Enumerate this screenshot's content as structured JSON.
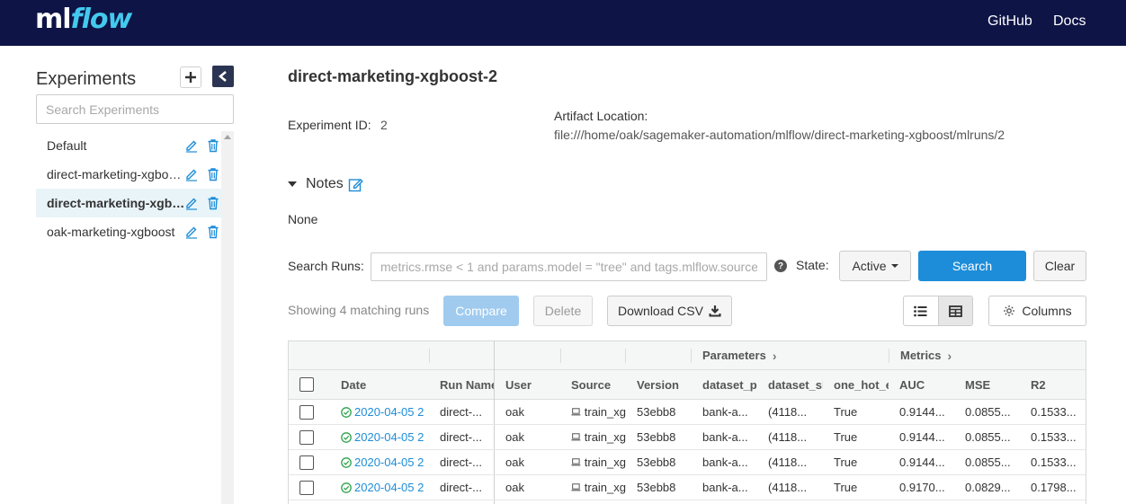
{
  "header": {
    "logo_ml": "ml",
    "logo_flow": "flow",
    "nav": [
      "GitHub",
      "Docs"
    ]
  },
  "sidebar": {
    "title": "Experiments",
    "search_placeholder": "Search Experiments",
    "experiments": [
      {
        "name": "Default",
        "active": false
      },
      {
        "name": "direct-marketing-xgboost",
        "active": false
      },
      {
        "name": "direct-marketing-xgboost-2",
        "active": true
      },
      {
        "name": "oak-marketing-xgboost",
        "active": false
      }
    ]
  },
  "experiment": {
    "title": "direct-marketing-xgboost-2",
    "id_label": "Experiment ID:",
    "id_value": "2",
    "artifact_label": "Artifact Location:",
    "artifact_value": "file:///home/oak/sagemaker-automation/mlflow/direct-marketing-xgboost/mlruns/2",
    "notes_label": "Notes",
    "notes_value": "None"
  },
  "search": {
    "label": "Search Runs:",
    "placeholder": "metrics.rmse < 1 and params.model = \"tree\" and tags.mlflow.source",
    "help_glyph": "?",
    "state_label": "State:",
    "state_value": "Active",
    "search_button": "Search",
    "clear_button": "Clear"
  },
  "toolbar": {
    "showing_text": "Showing 4 matching runs",
    "compare_button": "Compare",
    "delete_button": "Delete",
    "download_button": "Download CSV",
    "columns_button": "Columns"
  },
  "table": {
    "group_parameters": "Parameters",
    "group_metrics": "Metrics",
    "headers": [
      "Date",
      "Run Name",
      "User",
      "Source",
      "Version",
      "dataset_pa",
      "dataset_sh",
      "one_hot_e",
      "AUC",
      "MSE",
      "R2"
    ],
    "rows": [
      {
        "date": "2020-04-05 2",
        "run_name": "direct-...",
        "user": "oak",
        "source": "train_xg",
        "version": "53ebb8",
        "dataset_path": "bank-a...",
        "dataset_shape": "(4118...",
        "one_hot": "True",
        "auc": "0.9144...",
        "mse": "0.0855...",
        "r2": "0.1533..."
      },
      {
        "date": "2020-04-05 2",
        "run_name": "direct-...",
        "user": "oak",
        "source": "train_xg",
        "version": "53ebb8",
        "dataset_path": "bank-a...",
        "dataset_shape": "(4118...",
        "one_hot": "True",
        "auc": "0.9144...",
        "mse": "0.0855...",
        "r2": "0.1533..."
      },
      {
        "date": "2020-04-05 2",
        "run_name": "direct-...",
        "user": "oak",
        "source": "train_xg",
        "version": "53ebb8",
        "dataset_path": "bank-a...",
        "dataset_shape": "(4118...",
        "one_hot": "True",
        "auc": "0.9144...",
        "mse": "0.0855...",
        "r2": "0.1533..."
      },
      {
        "date": "2020-04-05 2",
        "run_name": "direct-...",
        "user": "oak",
        "source": "train_xg",
        "version": "53ebb8",
        "dataset_path": "bank-a...",
        "dataset_shape": "(4118...",
        "one_hot": "True",
        "auc": "0.9170...",
        "mse": "0.0829...",
        "r2": "0.1798..."
      }
    ]
  },
  "colors": {
    "header_bg": "#0e1446",
    "logo_accent": "#43c9ed",
    "primary": "#1d8dd9",
    "active_row": "#e9f4f8",
    "success": "#2ea44f"
  }
}
